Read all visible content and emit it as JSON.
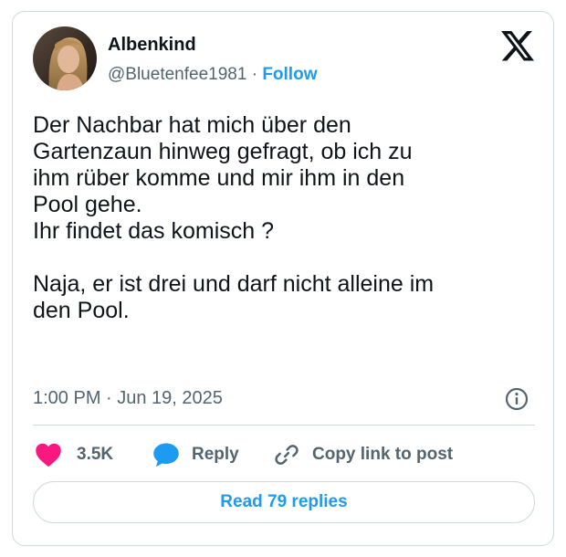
{
  "author": {
    "display_name": "Albenkind",
    "handle": "@Bluetenfee1981",
    "separator": "·",
    "follow_label": "Follow"
  },
  "brand": {
    "logo": "x-logo-icon",
    "color": "#0f1419"
  },
  "tweet": {
    "text": "Der Nachbar hat mich über den\nGartenzaun hinweg gefragt, ob ich zu\nihm rüber komme und mir ihm in den\nPool gehe.\nIhr findet das komisch ?\n\nNaja, er ist drei und darf nicht alleine im\nden Pool.",
    "timestamp": "1:00 PM · Jun 19, 2025"
  },
  "actions": {
    "like": {
      "icon": "heart-icon",
      "count": "3.5K",
      "color": "#f91880"
    },
    "reply": {
      "icon": "speech-bubble-icon",
      "label": "Reply",
      "color": "#1d9bf0"
    },
    "copy_link": {
      "icon": "link-icon",
      "label": "Copy link to post"
    }
  },
  "read_replies_label": "Read 79 replies",
  "colors": {
    "accent": "#1d9bf0",
    "secondary_text": "#536471",
    "border": "#cfd9de"
  }
}
